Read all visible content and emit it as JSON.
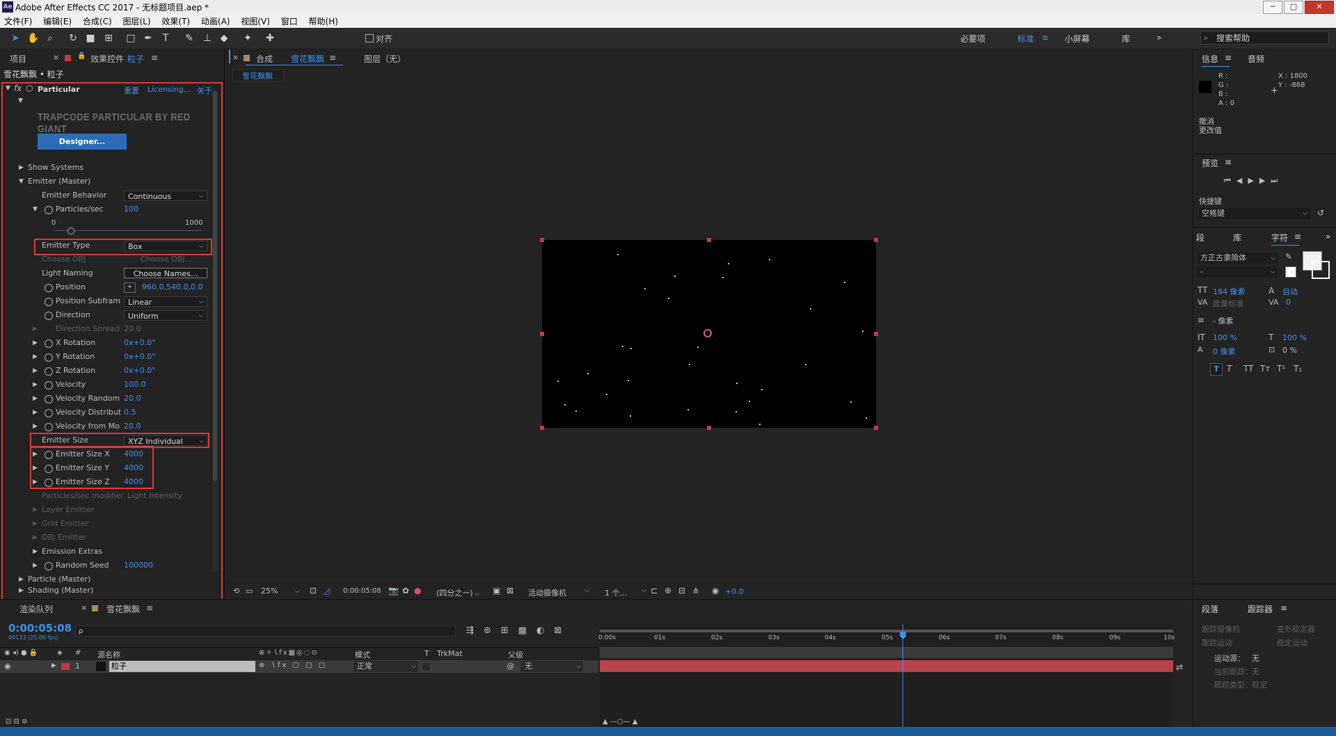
{
  "window": {
    "title": "Adobe After Effects CC 2017 - 无标题项目.aep *",
    "app_icon": "Ae"
  },
  "window_buttons": {
    "minimize": "─",
    "restore": "□",
    "close": "✕"
  },
  "menu": [
    "文件(F)",
    "编辑(E)",
    "合成(C)",
    "图层(L)",
    "效果(T)",
    "动画(A)",
    "视图(V)",
    "窗口",
    "帮助(H)"
  ],
  "toolbar": {
    "align_label": "对齐",
    "workspaces": [
      "必要项",
      "标准",
      "小屏幕",
      "库"
    ],
    "active_workspace": "标准",
    "search_placeholder": "搜索帮助"
  },
  "left_panel": {
    "tab_project": "项目",
    "tab_effects": "效果控件",
    "tab_effects_layer": "粒子",
    "breadcrumb": "雪花飘飘 • 粒子",
    "effect_name": "Particular",
    "reset": "重置",
    "licensing": "Licensing...",
    "about": "关于",
    "banner": "TRAPCODE PARTICULAR BY RED GIANT",
    "designer_button": "Designer...",
    "show_systems": "Show Systems",
    "emitter_master": "Emitter (Master)",
    "emitter_behavior_label": "Emitter Behavior",
    "emitter_behavior_value": "Continuous",
    "particles_sec_label": "Particles/sec",
    "particles_sec_value": "100",
    "slider_min": "0",
    "slider_max": "1000",
    "emitter_type_label": "Emitter Type",
    "emitter_type_value": "Box",
    "choose_obj_label": "Choose OBJ",
    "choose_obj_value": "Choose OBJ...",
    "light_naming_label": "Light Naming",
    "light_naming_value": "Choose Names...",
    "position_label": "Position",
    "position_value": "960.0,540.0,0.0",
    "position_subframe_label": "Position Subfram",
    "position_subframe_value": "Linear",
    "direction_label": "Direction",
    "direction_value": "Uniform",
    "direction_spread_label": "Direction Spread",
    "direction_spread_value": "20.0",
    "x_rotation_label": "X Rotation",
    "x_rotation_value": "0x+0.0°",
    "y_rotation_label": "Y Rotation",
    "y_rotation_value": "0x+0.0°",
    "z_rotation_label": "Z Rotation",
    "z_rotation_value": "0x+0.0°",
    "velocity_label": "Velocity",
    "velocity_value": "100.0",
    "velocity_random_label": "Velocity Random",
    "velocity_random_value": "20.0",
    "velocity_distrib_label": "Velocity Distribut",
    "velocity_distrib_value": "0.5",
    "velocity_from_label": "Velocity from Mo",
    "velocity_from_value": "20.0",
    "emitter_size_label": "Emitter Size",
    "emitter_size_value": "XYZ Individual",
    "emitter_size_x_label": "Emitter Size X",
    "emitter_size_x_value": "4000",
    "emitter_size_y_label": "Emitter Size Y",
    "emitter_size_y_value": "4000",
    "emitter_size_z_label": "Emitter Size Z",
    "emitter_size_z_value": "4000",
    "particles_modifier_label": "Particles/sec modifier",
    "particles_modifier_value": "Light Intensity",
    "layer_emitter": "Layer Emitter",
    "grid_emitter": "Grid Emitter",
    "obj_emitter": "OBJ Emitter",
    "emission_extras": "Emission Extras",
    "random_seed_label": "Random Seed",
    "random_seed_value": "100000",
    "particle_master": "Particle (Master)",
    "shading_master": "Shading (Master)"
  },
  "comp_panel": {
    "tab_label": "合成",
    "tab_comp": "雪花飘飘",
    "layer_tab": "图层（无）",
    "comp_tab_chip": "雪花飘飘",
    "zoom": "25%",
    "timecode": "0:00:05:08",
    "resolution": "(四分之一)",
    "camera": "活动摄像机",
    "views": "1 个...",
    "exposure": "+0.0"
  },
  "right_panel": {
    "info_tab": "信息",
    "audio_tab": "音频",
    "r": "R :",
    "g": "G :",
    "b": "B :",
    "a": "A : 0",
    "x": "X : 1800",
    "y": "Y : -868",
    "undo": "撤消",
    "change_value": "更改值",
    "preview_tab": "预览",
    "shortcut_label": "快捷键",
    "shortcut_value": "空格键",
    "para_tab": "段",
    "lib_tab": "库",
    "char_tab": "字符",
    "font_name": "方正古隶简体",
    "font_style": "-",
    "font_size": "184 像素",
    "leading": "自动",
    "kerning": "度量标准",
    "tracking": "0",
    "stroke": "- 像素",
    "vscale": "100 %",
    "hscale": "100 %",
    "baseline": "0 像素",
    "tsume": "0 %",
    "para2_tab": "段落",
    "tracker_tab": "跟踪器",
    "track_camera": "跟踪摄像机",
    "warp_stab": "变形稳定器",
    "track_motion": "跟踪运动",
    "stabilize": "稳定运动",
    "motion_source_label": "运动源：",
    "motion_source_value": "无",
    "current_track_label": "当前跟踪：",
    "current_track_value": "无",
    "track_type_label": "跟踪类型：",
    "track_type_value": "稳定"
  },
  "timeline": {
    "render_tab": "渲染队列",
    "comp_tab": "雪花飘飘",
    "timecode": "0:00:05:08",
    "frame_info": "00133 (25.00 fps)",
    "search_placeholder": "ρ",
    "col_source": "源名称",
    "col_mode": "模式",
    "col_t": "T",
    "col_trkmat": "TrkMat",
    "col_parent": "父级",
    "layer_num": "1",
    "layer_name": "粒子",
    "layer_mode": "正常",
    "layer_parent": "无",
    "ruler": [
      "0:00s",
      "01s",
      "02s",
      "03s",
      "04s",
      "05s",
      "06s",
      "07s",
      "08s",
      "09s",
      "10s"
    ],
    "playhead_seconds": 5.32,
    "duration_seconds": 10
  },
  "colors": {
    "accent": "#3f90ec",
    "highlight_box": "#e2383b",
    "layer_bar": "#b8434b"
  }
}
